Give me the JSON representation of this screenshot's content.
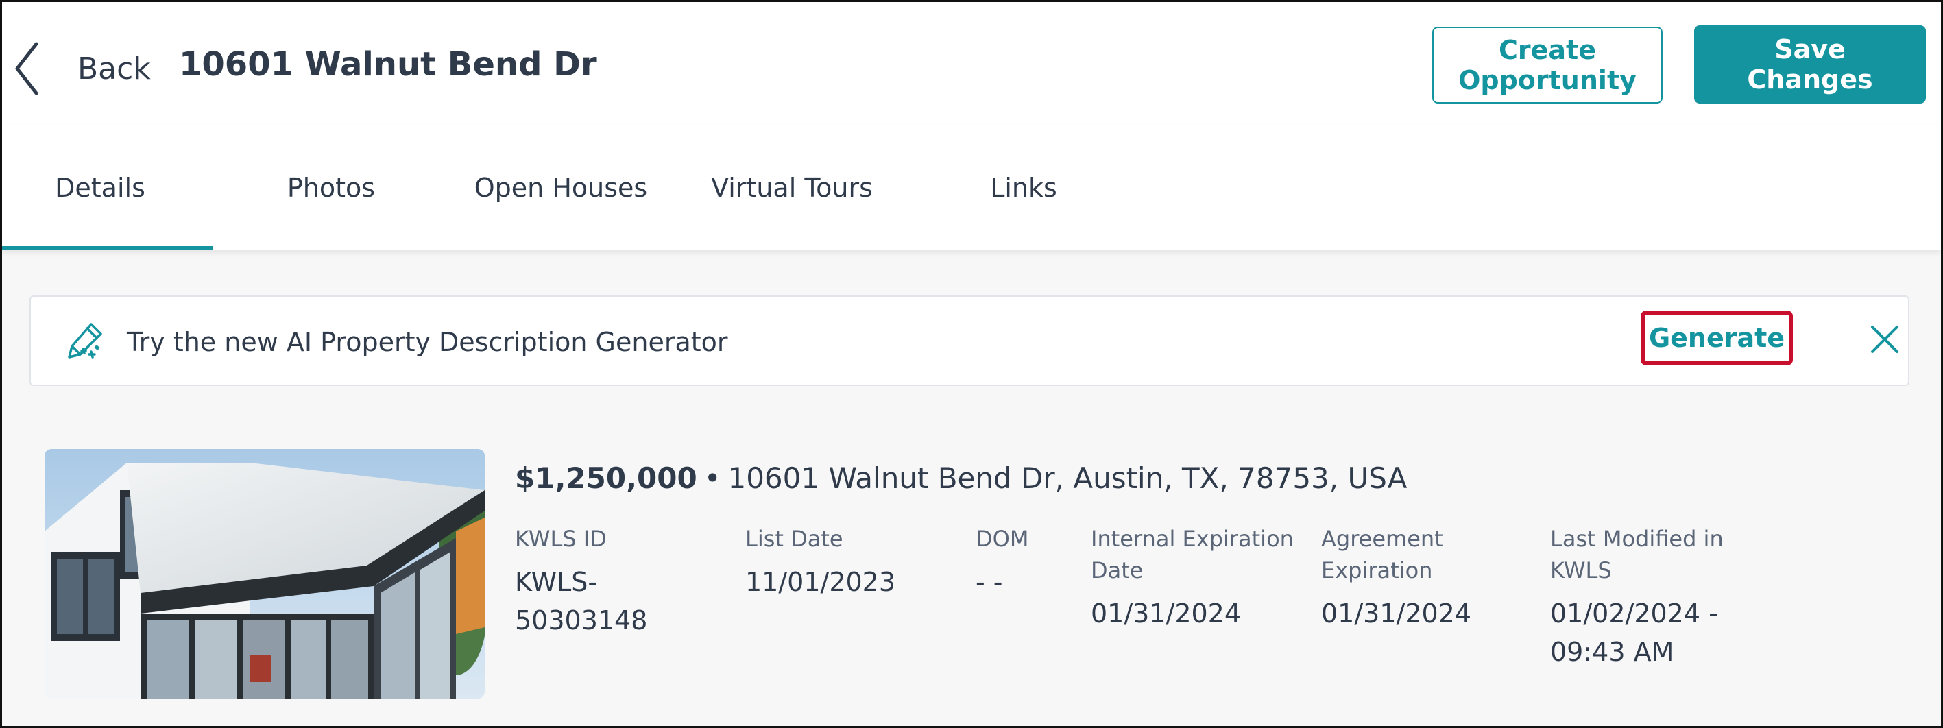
{
  "header": {
    "back_label": "Back",
    "title": "10601 Walnut Bend Dr",
    "create_opportunity_label": "Create\nOpportunity",
    "save_changes_label": "Save\nChanges"
  },
  "tabs": [
    {
      "label": "Details",
      "active": true
    },
    {
      "label": "Photos",
      "active": false
    },
    {
      "label": "Open Houses",
      "active": false
    },
    {
      "label": "Virtual Tours",
      "active": false
    },
    {
      "label": "Links",
      "active": false
    }
  ],
  "banner": {
    "icon": "magic-pen-icon",
    "text": "Try the new AI Property Description Generator",
    "generate_label": "Generate",
    "close_icon": "close-icon"
  },
  "listing": {
    "price": "$1,250,000",
    "separator": "•",
    "address": "10601 Walnut Bend Dr, Austin, TX, 78753, USA",
    "fields": [
      {
        "label": "KWLS ID",
        "value": "KWLS-\n50303148"
      },
      {
        "label": "List Date",
        "value": "11/01/2023"
      },
      {
        "label": "DOM",
        "value": "- -"
      },
      {
        "label": "Internal Expiration\nDate",
        "value": "01/31/2024"
      },
      {
        "label": "Agreement\nExpiration",
        "value": "01/31/2024"
      },
      {
        "label": "Last Modified in\nKWLS",
        "value": "01/02/2024 -\n09:43 AM"
      }
    ]
  },
  "colors": {
    "accent": "#14949f",
    "text": "#2f3a4b",
    "highlight": "#c8102e",
    "page_background": "#f7f7f7"
  }
}
